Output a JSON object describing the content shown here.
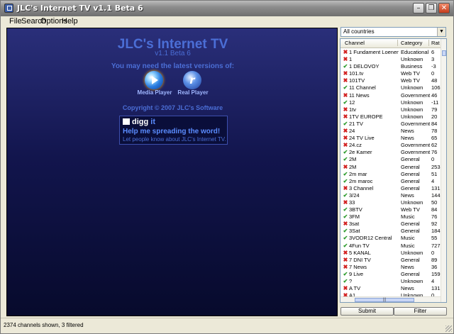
{
  "window": {
    "title": "JLC's Internet TV v1.1 Beta 6"
  },
  "menu": [
    "File",
    "Search",
    "Options",
    "Help"
  ],
  "promo": {
    "title": "JLC's Internet TV",
    "version": "v1.1 Beta 6",
    "need": "You may need the latest versions of:",
    "players": [
      "Media Player",
      "Real Player"
    ],
    "copyright": "Copyright © 2007 JLC's Software",
    "digg_label": "digg",
    "digg_it": "it",
    "help_text": "Help me spreading the word!",
    "let_text": "Let people know about JLC's Internet TV."
  },
  "filter": {
    "country": "All countries"
  },
  "table": {
    "columns": [
      "Channel",
      "Category",
      "Rat"
    ],
    "rows": [
      {
        "status": "bad",
        "channel": "1 Fundament Loenen",
        "category": "Educational",
        "rating": "6"
      },
      {
        "status": "bad",
        "channel": "1",
        "category": "Unknown",
        "rating": "3"
      },
      {
        "status": "ok",
        "channel": "1 DELOVOY",
        "category": "Business",
        "rating": "-3"
      },
      {
        "status": "bad",
        "channel": "101.tv",
        "category": "Web TV",
        "rating": "0"
      },
      {
        "status": "bad",
        "channel": "101TV",
        "category": "Web TV",
        "rating": "48"
      },
      {
        "status": "ok",
        "channel": "11 Channel",
        "category": "Unknown",
        "rating": "106"
      },
      {
        "status": "bad",
        "channel": "11 News",
        "category": "Government",
        "rating": "46"
      },
      {
        "status": "ok",
        "channel": "12",
        "category": "Unknown",
        "rating": "-11"
      },
      {
        "status": "bad",
        "channel": "1tv",
        "category": "Unknown",
        "rating": "79"
      },
      {
        "status": "bad",
        "channel": "1TV EUROPE",
        "category": "Unknown",
        "rating": "20"
      },
      {
        "status": "ok",
        "channel": "21 TV",
        "category": "Government",
        "rating": "84"
      },
      {
        "status": "bad",
        "channel": "24",
        "category": "News",
        "rating": "78"
      },
      {
        "status": "bad",
        "channel": "24 TV Live",
        "category": "News",
        "rating": "65"
      },
      {
        "status": "bad",
        "channel": "24.cz",
        "category": "Government",
        "rating": "62"
      },
      {
        "status": "ok",
        "channel": "2e Kamer",
        "category": "Government",
        "rating": "76"
      },
      {
        "status": "ok",
        "channel": "2M",
        "category": "General",
        "rating": "0"
      },
      {
        "status": "bad",
        "channel": "2M",
        "category": "General",
        "rating": "253"
      },
      {
        "status": "ok",
        "channel": "2m mar",
        "category": "General",
        "rating": "51"
      },
      {
        "status": "ok",
        "channel": "2m maroc",
        "category": "General",
        "rating": "4"
      },
      {
        "status": "bad",
        "channel": "3 Channel",
        "category": "General",
        "rating": "131"
      },
      {
        "status": "ok",
        "channel": "3/24",
        "category": "News",
        "rating": "144"
      },
      {
        "status": "bad",
        "channel": "33",
        "category": "Unknown",
        "rating": "50"
      },
      {
        "status": "ok",
        "channel": "3BTV",
        "category": "Web TV",
        "rating": "84"
      },
      {
        "status": "ok",
        "channel": "3FM",
        "category": "Music",
        "rating": "76"
      },
      {
        "status": "bad",
        "channel": "3sat",
        "category": "General",
        "rating": "92"
      },
      {
        "status": "ok",
        "channel": "3Sat",
        "category": "General",
        "rating": "184"
      },
      {
        "status": "ok",
        "channel": "3VODR12 Central",
        "category": "Music",
        "rating": "55"
      },
      {
        "status": "ok",
        "channel": "4Fun TV",
        "category": "Music",
        "rating": "727"
      },
      {
        "status": "bad",
        "channel": "5 KANAL",
        "category": "Unknown",
        "rating": "0"
      },
      {
        "status": "bad",
        "channel": "7 DNI TV",
        "category": "General",
        "rating": "89"
      },
      {
        "status": "bad",
        "channel": "7 News",
        "category": "News",
        "rating": "36"
      },
      {
        "status": "ok",
        "channel": "9 Live",
        "category": "General",
        "rating": "159"
      },
      {
        "status": "ok",
        "channel": "?",
        "category": "Unknown",
        "rating": "4"
      },
      {
        "status": "bad",
        "channel": "A TV",
        "category": "News",
        "rating": "131"
      },
      {
        "status": "bad",
        "channel": "A1",
        "category": "Unknown",
        "rating": "0"
      }
    ]
  },
  "buttons": {
    "submit": "Submit",
    "filter": "Filter"
  },
  "status": {
    "text": "2374 channels shown, 3 filtered"
  },
  "colors": {
    "accent": "#4b6ed6",
    "ok": "#2e9b2e",
    "bad": "#d22020"
  }
}
